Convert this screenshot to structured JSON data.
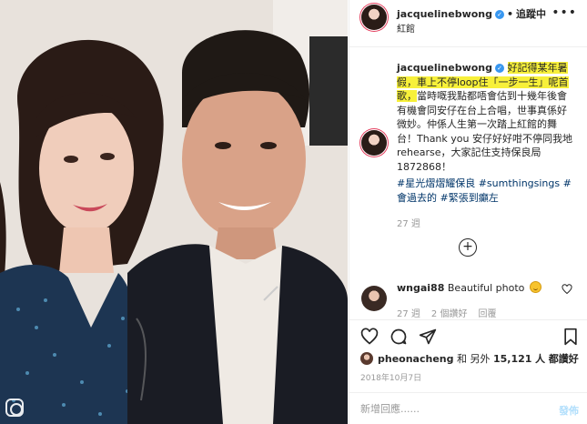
{
  "header": {
    "username": "jacquelinebwong",
    "dot": "•",
    "follow_label": "追蹤中",
    "location": "紅館",
    "more": "•••"
  },
  "caption": {
    "username": "jacquelinebwong",
    "text_highlight_1": "好記得某年暑假，車上不停loop住「一步一生」呢首歌，",
    "text_plain": "當時嘅我點都唔會估到十幾年後會有機會同安仔在台上合唱，世事真係好微妙。仲係人生第一次踏上紅館的舞台！Thank you 安仔好好咁不停同我地rehearse，大家記住支持保良局 1872868！",
    "hashtags": "#星光熠熠耀保良 #sumthingsings #會過去的 #緊張到癲左",
    "time": "27 週"
  },
  "comment": {
    "username": "wngai88",
    "text": "Beautiful photo",
    "time": "27 週",
    "likes": "2 個讚好",
    "reply": "回覆"
  },
  "likes": {
    "username": "pheonacheng",
    "and": "和 另外",
    "count": "15,121",
    "suffix": "人 都讚好"
  },
  "post_date": "2018年10月7日",
  "add_comment": {
    "placeholder": "新增回應......",
    "post_label": "發佈"
  },
  "colors": {
    "link": "#003569",
    "highlight": "#f7f03a",
    "verified": "#3897f0"
  }
}
